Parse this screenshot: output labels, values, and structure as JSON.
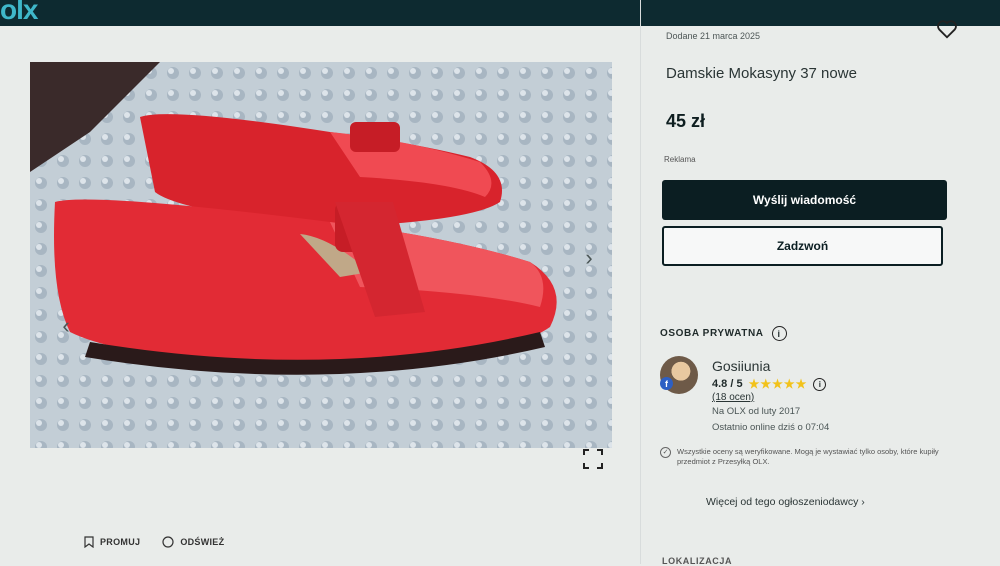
{
  "header": {
    "logo_text": "olx",
    "brand_color": "#3fb7c9",
    "bar_color": "#0d2a30"
  },
  "listing": {
    "posted_date": "Dodane 21 marca 2025",
    "title": "Damskie Mokasyny 37 nowe",
    "price": "45 zł",
    "ad_label": "Reklama",
    "favorite_icon": "heart-icon"
  },
  "gallery": {
    "prev_icon": "chevron-left-icon",
    "next_icon": "chevron-right-icon",
    "expand_icon": "fullscreen-icon",
    "shoe_color": "#e22b35"
  },
  "actions": {
    "message_label": "Wyślij wiadomość",
    "call_label": "Zadzwoń",
    "promote_label": "PROMUJ",
    "refresh_label": "ODŚWIEŻ"
  },
  "seller": {
    "type_label": "OSOBA PRYWATNA",
    "name": "Gosiiunia",
    "rating": "4.8 / 5",
    "stars": 5,
    "reviews_label": "(18 ocen)",
    "member_since": "Na OLX od luty 2017",
    "last_online": "Ostatnio online dziś o 07:04",
    "verified_note": "Wszystkie oceny są weryfikowane. Mogą je wystawiać tylko osoby, które kupiły przedmiot z Przesyłką OLX.",
    "more_ads_label": "Więcej od tego ogłoszeniodawcy"
  },
  "location": {
    "label": "LOKALIZACJA"
  }
}
